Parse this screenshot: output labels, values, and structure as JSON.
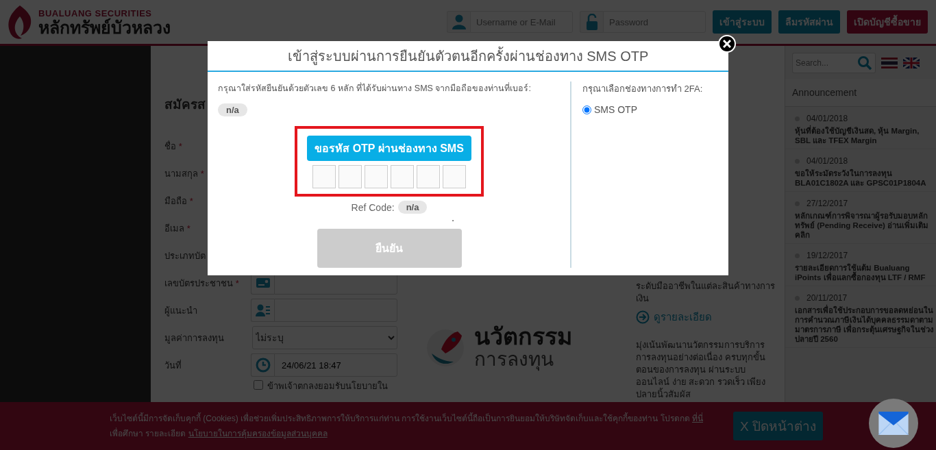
{
  "header": {
    "logo_en": "BUALUANG SECURITIES",
    "logo_th": "หลักทรัพย์บัวหลวง",
    "username_placeholder": "Username or E-Mail",
    "password_placeholder": "Password",
    "buttons": [
      {
        "label": "เข้าสู่ระบบ",
        "kind": "primary"
      },
      {
        "label": "ลืมรหัสผ่าน",
        "kind": "primary"
      },
      {
        "label": "เปิดบัญชีซื้อขาย",
        "kind": "accent"
      }
    ]
  },
  "register_form": {
    "title": "สมัครส",
    "fields": [
      {
        "label": "ชื่อ",
        "mark": "*",
        "kind": "covered"
      },
      {
        "label": "นามสกุล",
        "mark": "*",
        "kind": "covered"
      },
      {
        "label": "มือถือ",
        "mark": "*",
        "kind": "covered"
      },
      {
        "label": "อีเมล",
        "mark": "*",
        "kind": "covered"
      },
      {
        "label": "ประเภทบัต",
        "kind": "covered"
      },
      {
        "label": "เลขบัตรประชาชน",
        "mark": "*",
        "kind": "card-input"
      },
      {
        "label": "ผู้แนะนำ",
        "kind": "person-input"
      },
      {
        "label": "มูลค่าการลงทุน",
        "kind": "select",
        "value": "ไม่ระบุ"
      },
      {
        "label": "วันที่",
        "kind": "date",
        "value": "24/06/21 18:47"
      }
    ],
    "consent": {
      "label": "ข้าพเจ้าตกลงยอมรับนโยบายใน",
      "checked": false
    }
  },
  "promo": {
    "title": "นวัตกรรม",
    "subtitle": "การลงทุน"
  },
  "features": [
    {
      "text": "ระดับมืออาชีพในแต่ละสินค้าทางการเงิน",
      "link": "ดูรายละเอียด"
    },
    {
      "text": "มุ่งเน้นพัฒนานวัตกรรมการบริการการลงทุนอย่างต่อเนื่อง ครบทุกขั้นตอนของการลงทุน ผ่านระบบออนไลน์ ง่าย สะดวก รวดเร็ว เพียงปลายนิ้วสัมผัส"
    }
  ],
  "sidebar": {
    "search_placeholder": "Search...",
    "announcement_title": "Announcement",
    "announcements": [
      {
        "date": "04/01/2018",
        "title": "หุ้นที่ต้องใช้บัญชีเงินสด, หุ้น Margin, SBL และ TFEX Margin"
      },
      {
        "date": "04/01/2018",
        "title": "ขอให้ระมัดระวังในการลงทุน BLA01C1802A และ GPSC01P1804A"
      },
      {
        "date": "27/12/2017",
        "title": "หลักเกณฑ์การพิจารณาผู้รอรับมอบหลักทรัพย์ (Pending Receive) อ่านเพิ่มเติมคลิก"
      },
      {
        "date": "19/12/2017",
        "title": "รายละเอียดการใช้แต้ม Bualuang iPoints เพื่อแลกซื้อกองทุน LTF / RMF"
      },
      {
        "date": "20/11/2017",
        "title": "เอกสารเพื่อใช้ประกอบการขอลดหย่อนในการคำนวณภาษีเงินได้บุคคลธรรมดาตามมาตรการภาษี เพื่อกระตุ้นเศรษฐกิจในช่วงปลายปี 2560"
      }
    ]
  },
  "cookie_bar": {
    "text_before": "เว็บไซต์นี้มีการจัดเก็บคุกกี้ (Cookies) เพื่อช่วยเพิ่มประสิทธิภาพการให้บริการแก่ท่าน การใช้งานเว็บไซต์นี้ถือเป็นการยินยอมให้บริษัทจัดเก็บและใช้คุกกี้ของท่าน โปรดกด",
    "link": "ที่นี่",
    "text_after": "เพื่อศึกษา รายละเอียด",
    "policy_link": "นโยบายในการคุ้มครองข้อมูลส่วนบุคคล",
    "close_label": "X ปิดหน้าต่าง"
  },
  "modal": {
    "title": "เข้าสู่ระบบผ่านการยืนยันตัวตนอีกครั้งผ่านช่องทาง SMS OTP",
    "instruction": "กรุณาใส่รหัสยืนยันด้วยตัวเลข 6 หลัก ที่ได้รับผ่านทาง SMS จากมือถือของท่านที่เบอร์:",
    "phone": "n/a",
    "otp_button": "ขอรหัส OTP ผ่านช่องทาง SMS",
    "otp_boxes": [
      {
        "filled": false
      },
      {
        "filled": false
      },
      {
        "filled": false
      },
      {
        "filled": false
      },
      {
        "filled": false
      },
      {
        "filled": false
      }
    ],
    "ref_label": "Ref Code:",
    "ref_value": "n/a",
    "note": ".",
    "confirm": {
      "label": "ยืนยัน",
      "disabled": true
    },
    "channel_prompt": "กรุณาเลือกช่องทางการทำ 2FA:",
    "channels": [
      {
        "label": "SMS OTP",
        "selected": true
      }
    ]
  }
}
